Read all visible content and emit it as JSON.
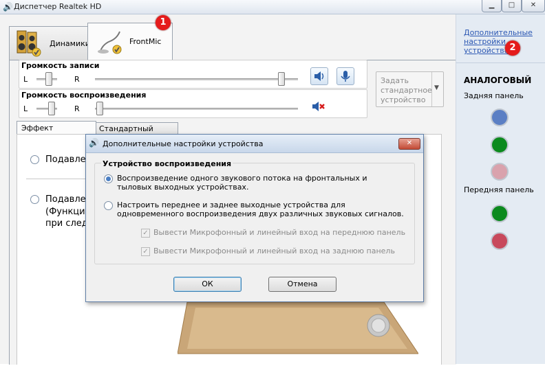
{
  "window": {
    "title": "Диспетчер Realtek HD"
  },
  "tabs": [
    {
      "label": "Динамики"
    },
    {
      "label": "FrontMic"
    }
  ],
  "badges": [
    "1",
    "2"
  ],
  "record_volume": {
    "label": "Громкость записи",
    "l": "L",
    "r": "R"
  },
  "playback_volume": {
    "label": "Громкость воспроизведения",
    "l": "L",
    "r": "R"
  },
  "default_device": {
    "label": "Задать стандартное устройство"
  },
  "subtabs": [
    {
      "label": "Эффект микрофона"
    },
    {
      "label": "Стандартный формат"
    }
  ],
  "background_text": {
    "suppress1": "Подавлен",
    "suppress2": "Подавлен",
    "func": "(Функция",
    "next": "при следу"
  },
  "right_panel": {
    "link": "Дополнительные настройки устройства",
    "analog": "АНАЛОГОВЫЙ",
    "rear": "Задняя панель",
    "front": "Передняя панель"
  },
  "jack_colors": {
    "blue": "#5b7fc4",
    "green": "#0c8a1e",
    "pink": "#d9a2ad",
    "red": "#c8495c"
  },
  "dialog": {
    "title": "Дополнительные настройки устройства",
    "group": "Устройство воспроизведения",
    "option1": "Воспроизведение одного звукового потока на фронтальных и тыловых выходных устройствах.",
    "option2": "Настроить переднее и заднее выходные устройства для одновременного воспроизведения двух различных звуковых сигналов.",
    "check1": "Вывести Микрофонный и линейный вход на переднюю панель",
    "check2": "Вывести Микрофонный и линейный вход на заднюю панель",
    "ok": "ОК",
    "cancel": "Отмена"
  }
}
